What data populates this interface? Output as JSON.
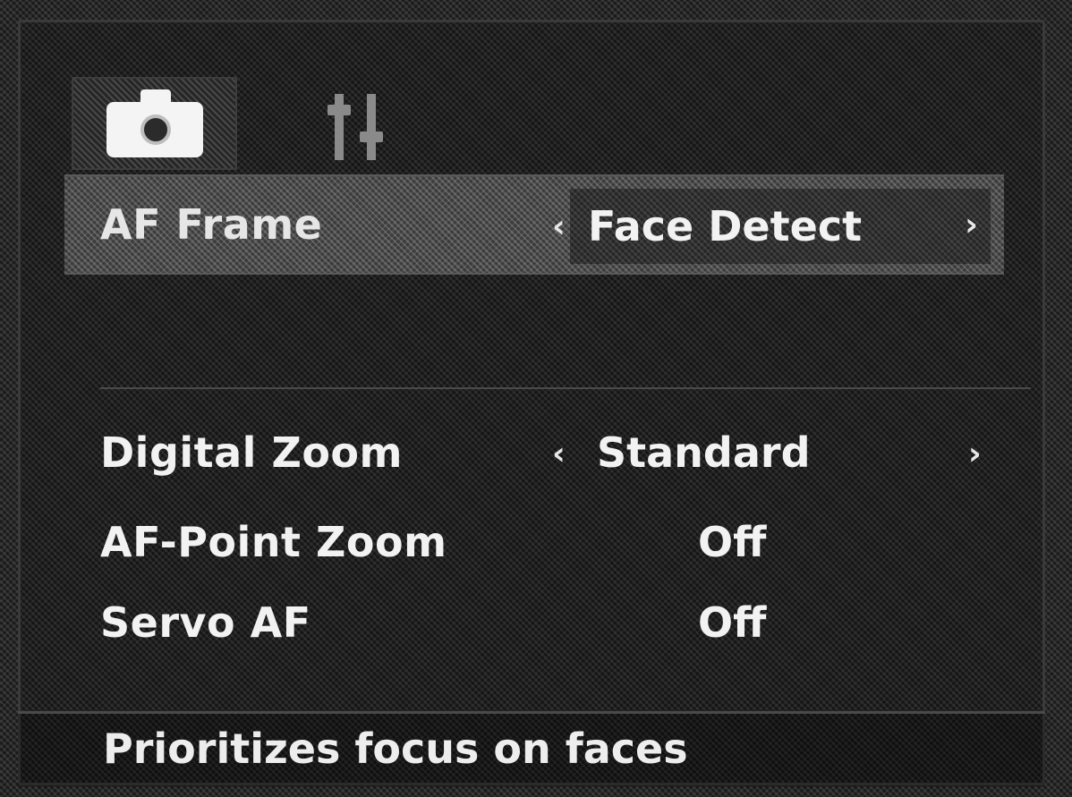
{
  "tabs": [
    {
      "icon": "camera-icon",
      "active": true
    },
    {
      "icon": "settings-icon",
      "active": false
    }
  ],
  "menu": {
    "af_frame": {
      "label": "AF Frame",
      "value": "Face Detect"
    },
    "digital_zoom": {
      "label": "Digital Zoom",
      "value": "Standard"
    },
    "af_point_zoom": {
      "label": "AF-Point Zoom",
      "value": "Off"
    },
    "servo_af": {
      "label": "Servo AF",
      "value": "Off"
    }
  },
  "arrows": {
    "left": "‹",
    "right": "›"
  },
  "hint": "Prioritizes focus on faces",
  "colors": {
    "background": "#1a1a1a",
    "selected_row": "#3a3a3a",
    "text": "#f2f2f2"
  }
}
